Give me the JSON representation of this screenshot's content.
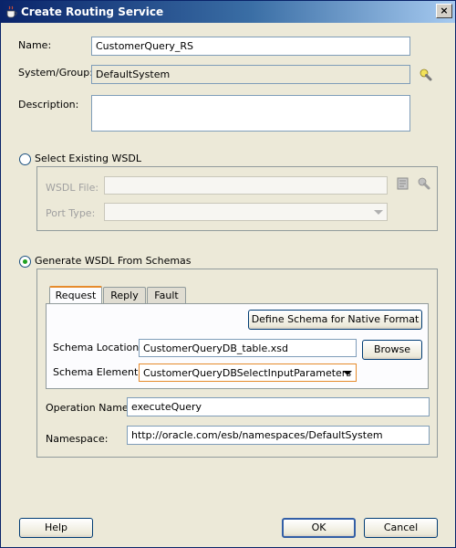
{
  "window": {
    "title": "Create Routing Service"
  },
  "form": {
    "name": {
      "label": "Name:",
      "value": "CustomerQuery_RS"
    },
    "system_group": {
      "label": "System/Group:",
      "value": "DefaultSystem"
    },
    "description": {
      "label": "Description:",
      "value": ""
    }
  },
  "existing_wsdl": {
    "radio_label": "Select Existing WSDL",
    "selected": false,
    "wsdl_file": {
      "label": "WSDL File:",
      "value": ""
    },
    "port_type": {
      "label": "Port Type:",
      "value": ""
    }
  },
  "generate_wsdl": {
    "radio_label": "Generate WSDL From Schemas",
    "selected": true,
    "tabs": [
      {
        "label": "Request",
        "active": true
      },
      {
        "label": "Reply",
        "active": false
      },
      {
        "label": "Fault",
        "active": false
      }
    ],
    "define_schema_button": "Define Schema for Native Format",
    "schema_location": {
      "label": "Schema Location:",
      "value": "CustomerQueryDB_table.xsd"
    },
    "browse_button": "Browse",
    "schema_element": {
      "label": "Schema Element:",
      "value": "CustomerQueryDBSelectInputParameters"
    },
    "operation_name": {
      "label": "Operation Name:",
      "value": "executeQuery"
    },
    "namespace": {
      "label": "Namespace:",
      "value": "http://oracle.com/esb/namespaces/DefaultSystem"
    }
  },
  "buttons": {
    "help": "Help",
    "ok": "OK",
    "cancel": "Cancel"
  },
  "colors": {
    "title_start": "#0a246a",
    "title_end": "#a6caf0",
    "window_bg": "#ece9d8",
    "active_tab_accent": "#e68b2c",
    "radio_dot": "#21a121"
  }
}
